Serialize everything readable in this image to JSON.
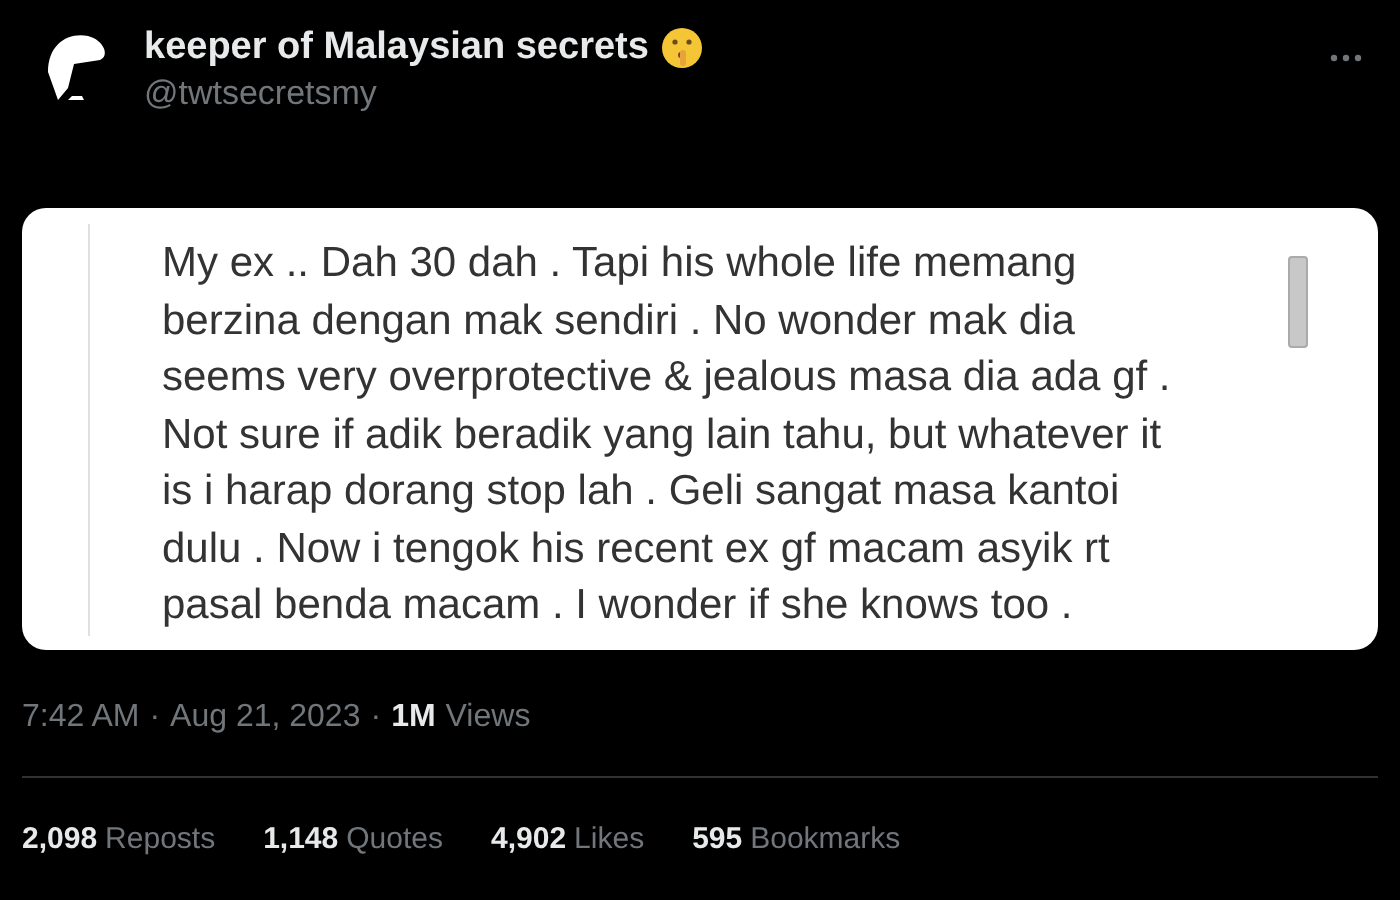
{
  "author": {
    "name": "keeper of Malaysian secrets",
    "handle": "@twtsecretsmy"
  },
  "note_lines": [
    "My ex .. Dah 30 dah . Tapi his whole life memang",
    "berzina dengan mak sendiri . No wonder mak dia",
    "seems very overprotective & jealous masa dia ada gf .",
    "Not sure if adik beradik yang lain tahu, but whatever it",
    "is i harap dorang stop lah . Geli sangat masa kantoi",
    "dulu . Now i tengok his recent ex gf macam asyik rt",
    "pasal benda macam . I wonder if she knows too ."
  ],
  "meta": {
    "time": "7:42 AM",
    "separator_1": "·",
    "date": "Aug 21, 2023",
    "separator_2": "·",
    "views_count": "1M",
    "views_label": "Views"
  },
  "stats": [
    {
      "count": "2,098",
      "label": "Reposts"
    },
    {
      "count": "1,148",
      "label": "Quotes"
    },
    {
      "count": "4,902",
      "label": "Likes"
    },
    {
      "count": "595",
      "label": "Bookmarks"
    }
  ]
}
